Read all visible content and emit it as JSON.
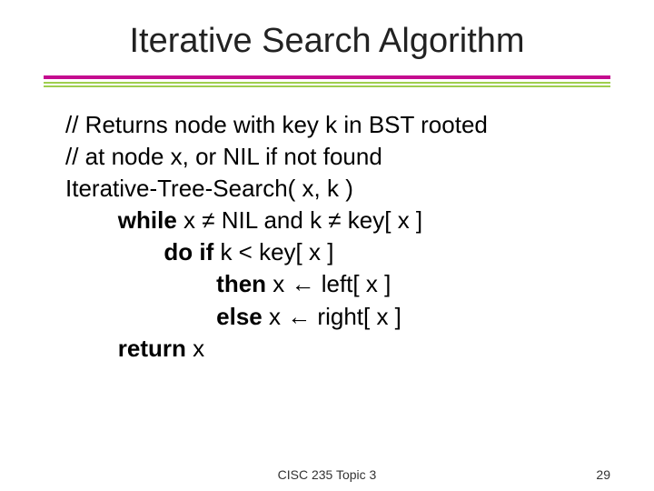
{
  "title": "Iterative Search Algorithm",
  "code": {
    "l1": "// Returns node with key k in BST rooted",
    "l2": "// at node x, or NIL if not found",
    "l3": "Iterative-Tree-Search( x, k )",
    "l4a": "while",
    "l4b": " x ≠ NIL and k ≠ key[ x ]",
    "l5a": "do if",
    "l5b": " k < key[ x ]",
    "l6a": "then",
    "l6b": " x ← left[ x ]",
    "l7a": "else",
    "l7b": " x ← right[ x ]",
    "l8a": "return",
    "l8b": " x"
  },
  "footer": {
    "center": "CISC 235 Topic 3",
    "page": "29"
  }
}
